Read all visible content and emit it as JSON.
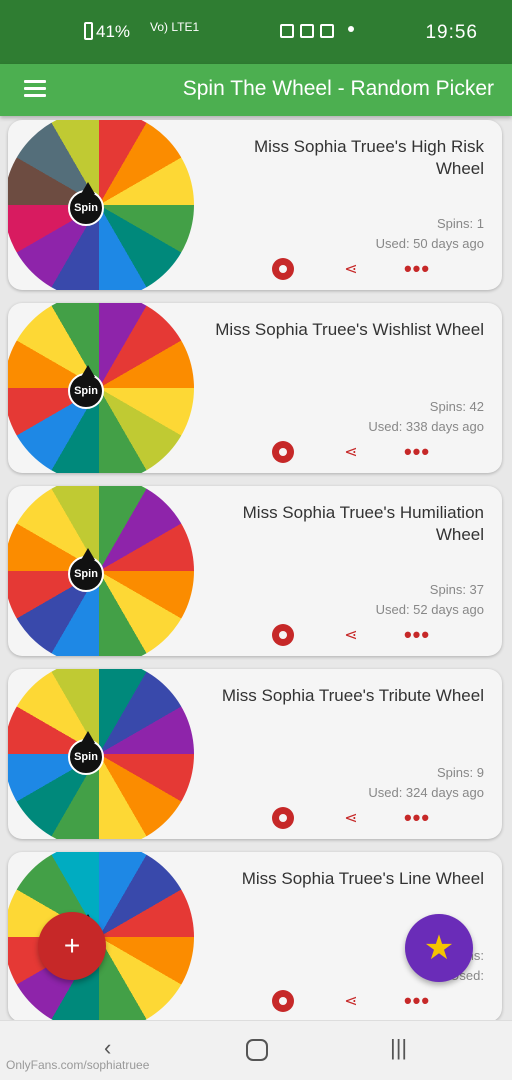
{
  "statusbar": {
    "time": "19:56",
    "battery": "41%",
    "signal_text": "Vo) LTE1"
  },
  "appbar": {
    "title": "Spin The Wheel - Random Picker"
  },
  "spin_label": "Spin",
  "cards": [
    {
      "title": "Miss Sophia Truee's High Risk Wheel",
      "spins": "Spins: 1",
      "used": "Used: 50 days ago"
    },
    {
      "title": "Miss Sophia Truee's Wishlist Wheel",
      "spins": "Spins: 42",
      "used": "Used: 338 days ago"
    },
    {
      "title": "Miss Sophia Truee's Humiliation Wheel",
      "spins": "Spins: 37",
      "used": "Used: 52 days ago"
    },
    {
      "title": "Miss Sophia Truee's Tribute Wheel",
      "spins": "Spins: 9",
      "used": "Used: 324 days ago"
    },
    {
      "title": "Miss Sophia Truee's Line Wheel",
      "spins": "Spins:",
      "used": "Used:"
    }
  ],
  "fab": {
    "add": "+",
    "star": "★"
  },
  "navbar": {
    "back": "‹",
    "recent": "|||"
  },
  "watermark": "OnlyFans.com/sophiatruee",
  "colors": {
    "statusbar": "#2f7d32",
    "appbar": "#4caf50",
    "accent_red": "#c62828",
    "fab_purple": "#6a2cb8"
  }
}
